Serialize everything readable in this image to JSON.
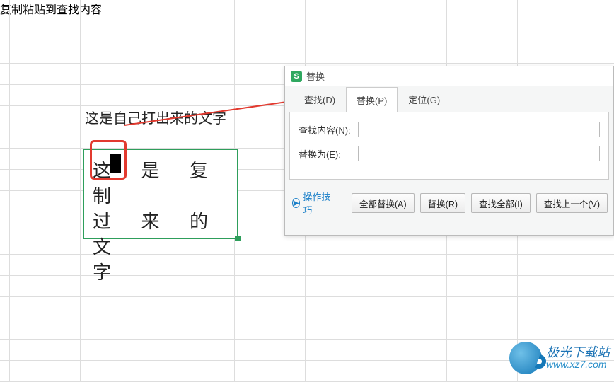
{
  "cells": {
    "typed_text": "这是自己打出来的文字",
    "copied_row1": "这 是 复 制",
    "copied_row2": "过 来 的 文",
    "copied_row3": "字"
  },
  "annotation": {
    "hint": "复制粘贴到查找内容"
  },
  "dialog": {
    "title": "替换",
    "tabs": {
      "find": "查找(D)",
      "replace": "替换(P)",
      "goto": "定位(G)"
    },
    "labels": {
      "find_what": "查找内容(N):",
      "replace_with": "替换为(E):"
    },
    "inputs": {
      "find_value": "",
      "replace_value": ""
    },
    "tips_link": "操作技巧",
    "buttons": {
      "replace_all": "全部替换(A)",
      "replace": "替换(R)",
      "find_all": "查找全部(I)",
      "find_prev": "查找上一个(V)"
    },
    "icon_letter": "S"
  },
  "watermark": {
    "site_cn": "极光下载站",
    "site_url": "www.xz7.com"
  }
}
